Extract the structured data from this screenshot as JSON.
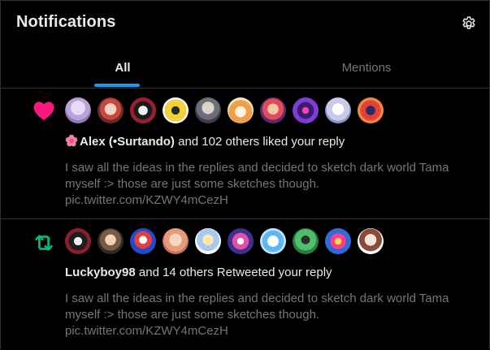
{
  "header": {
    "title": "Notifications",
    "settings_icon": "gear-icon"
  },
  "tabs": [
    {
      "label": "All",
      "active": true
    },
    {
      "label": "Mentions",
      "active": false
    }
  ],
  "colors": {
    "background": "#000000",
    "accent": "#1d9bf0",
    "like": "#f91880",
    "retweet": "#00ba7c",
    "muted_text": "#71767b",
    "divider": "#2f3336"
  },
  "notifications": [
    {
      "type": "like",
      "icon": "heart-icon",
      "avatar_count": 10,
      "emoji": "hibiscus",
      "actor_name": "Alex (•Surtando)",
      "action_text": " and 102 others liked your reply",
      "preview_lines": [
        "I saw all the ideas in the replies and decided to sketch dark world Tama",
        "myself :> those are just some sketches though."
      ],
      "preview_link": "pic.twitter.com/KZWY4mCezH"
    },
    {
      "type": "retweet",
      "icon": "retweet-icon",
      "avatar_count": 10,
      "actor_name": "Luckyboy98",
      "action_text": " and 14 others Retweeted your reply",
      "preview_lines": [
        "I saw all the ideas in the replies and decided to sketch dark world Tama",
        "myself :> those are just some sketches though."
      ],
      "preview_link": "pic.twitter.com/KZWY4mCezH"
    }
  ]
}
